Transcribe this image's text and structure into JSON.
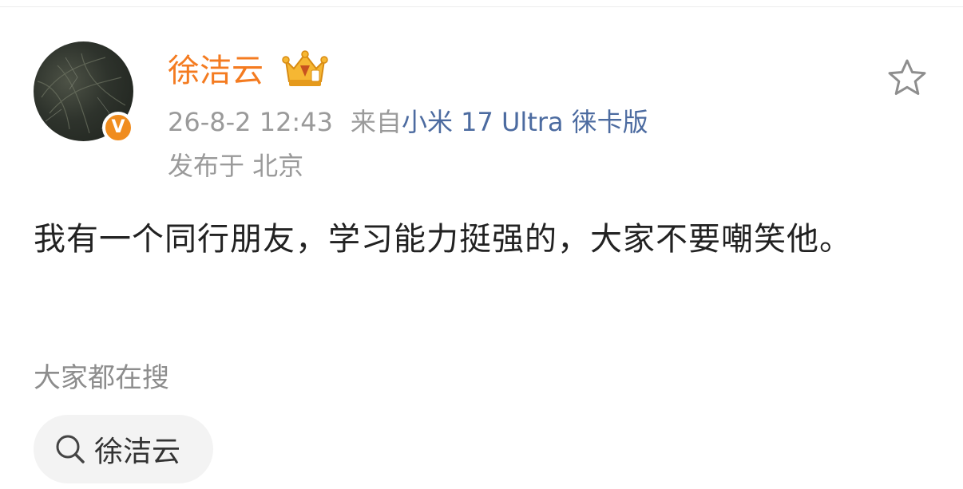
{
  "post": {
    "author": "徐洁云",
    "time": "26-8-2 12:43",
    "from_prefix": "来自",
    "device": "小米 17 Ultra 徕卡版",
    "location": "发布于 北京",
    "text": "我有一个同行朋友，学习能力挺强的，大家不要嘲笑他。"
  },
  "badges": {
    "verified_letter": "V",
    "verified_color": "#f08c1e",
    "crown_icon": "gold-crown-icon"
  },
  "trending": {
    "title": "大家都在搜",
    "items": [
      {
        "label": "徐洁云",
        "icon": "search-icon"
      }
    ]
  },
  "colors": {
    "username": "#f47b20",
    "device_link": "#4c6ba0"
  }
}
